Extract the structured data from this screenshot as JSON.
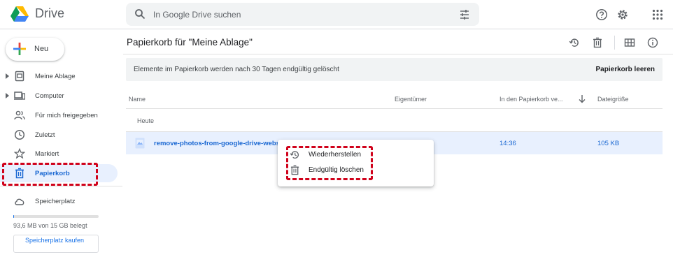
{
  "app": {
    "name": "Drive"
  },
  "search": {
    "placeholder": "In Google Drive suchen"
  },
  "header_icons": [
    "search-icon",
    "tune-icon",
    "help-icon",
    "settings-icon",
    "apps-grid-icon"
  ],
  "sidebar": {
    "new_label": "Neu",
    "items": [
      {
        "label": "Meine Ablage",
        "icon": "my-drive-icon"
      },
      {
        "label": "Computer",
        "icon": "computer-icon"
      },
      {
        "label": "Für mich freigegeben",
        "icon": "shared-icon"
      },
      {
        "label": "Zuletzt",
        "icon": "clock-icon"
      },
      {
        "label": "Markiert",
        "icon": "star-icon"
      },
      {
        "label": "Papierkorb",
        "icon": "trash-icon"
      },
      {
        "label": "Speicherplatz",
        "icon": "cloud-icon"
      }
    ],
    "active_item": "Papierkorb",
    "storage_text": "93,6 MB von 15 GB belegt",
    "storage_fraction": 0.006,
    "buy_storage_label": "Speicherplatz kaufen"
  },
  "main": {
    "title": "Papierkorb für \"Meine Ablage\"",
    "banner_text": "Elemente im Papierkorb werden nach 30 Tagen endgültig gelöscht",
    "empty_trash_label": "Papierkorb leeren",
    "columns": {
      "name": "Name",
      "owner": "Eigentümer",
      "trashed_date": "In den Papierkorb ve...",
      "size": "Dateigröße"
    },
    "group_label": "Heute",
    "files": [
      {
        "name": "remove-photos-from-google-drive-website.j",
        "owner": "",
        "trashed_date": "14:36",
        "size": "105 KB"
      }
    ]
  },
  "context_menu": {
    "items": [
      {
        "label": "Wiederherstellen",
        "icon": "restore-icon"
      },
      {
        "label": "Endgültig löschen",
        "icon": "trash-icon"
      }
    ]
  },
  "colors": {
    "accent": "#1a73e8",
    "selection": "#e8f0fe",
    "highlight": "#d0021b"
  }
}
